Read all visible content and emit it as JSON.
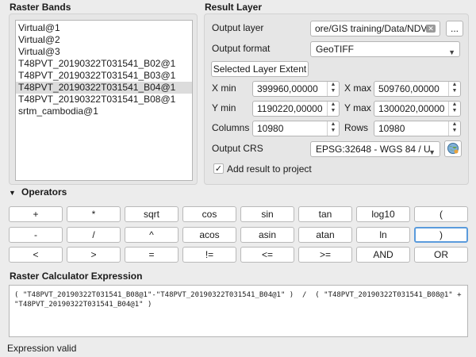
{
  "raster_bands": {
    "title": "Raster Bands",
    "items": [
      "Virtual@1",
      "Virtual@2",
      "Virtual@3",
      "T48PVT_20190322T031541_B02@1",
      "T48PVT_20190322T031541_B03@1",
      "T48PVT_20190322T031541_B04@1",
      "T48PVT_20190322T031541_B08@1",
      "srtm_cambodia@1"
    ],
    "selected_index": 5
  },
  "result_layer": {
    "title": "Result Layer",
    "output_layer_label": "Output layer",
    "output_layer_value": "ore/GIS training/Data/NDVI",
    "browse_label": "...",
    "output_format_label": "Output format",
    "output_format_value": "GeoTIFF",
    "selected_extent_label": "Selected Layer Extent",
    "xmin_label": "X min",
    "xmin_value": "399960,00000",
    "xmax_label": "X max",
    "xmax_value": "509760,00000",
    "ymin_label": "Y min",
    "ymin_value": "1190220,00000",
    "ymax_label": "Y max",
    "ymax_value": "1300020,00000",
    "columns_label": "Columns",
    "columns_value": "10980",
    "rows_label": "Rows",
    "rows_value": "10980",
    "output_crs_label": "Output CRS",
    "output_crs_value": "EPSG:32648 - WGS 84 / U",
    "add_result_label": "Add result to project",
    "add_result_checked": true
  },
  "operators": {
    "title": "Operators",
    "rows": [
      [
        "+",
        "*",
        "sqrt",
        "cos",
        "sin",
        "tan",
        "log10",
        "("
      ],
      [
        "-",
        "/",
        "^",
        "acos",
        "asin",
        "atan",
        "ln",
        ")"
      ],
      [
        "<",
        ">",
        "=",
        "!=",
        "<=",
        ">=",
        "AND",
        "OR"
      ]
    ]
  },
  "expression": {
    "title": "Raster Calculator Expression",
    "text": "( \"T48PVT_20190322T031541_B08@1\"-\"T48PVT_20190322T031541_B04@1\" )  /  ( \"T48PVT_20190322T031541_B08@1\" +\n\"T48PVT_20190322T031541_B04@1\" )",
    "status": "Expression valid"
  }
}
